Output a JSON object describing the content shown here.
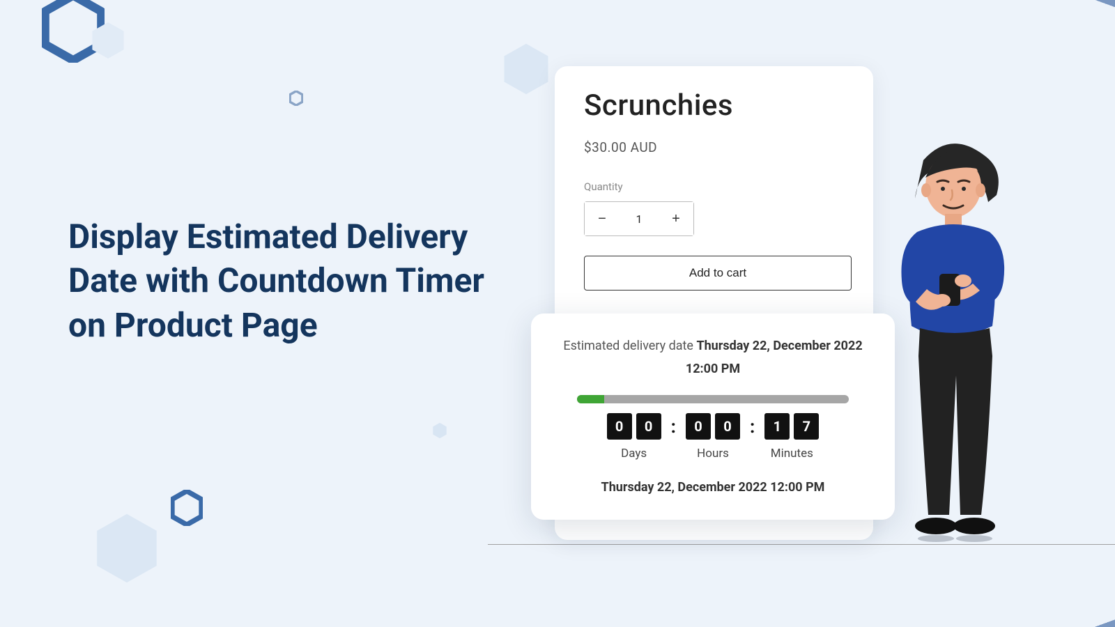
{
  "headline": "Display Estimated Delivery Date with Countdown Timer on Product Page",
  "product": {
    "title": "Scrunchies",
    "price": "$30.00 AUD",
    "quantity_label": "Quantity",
    "quantity_value": "1",
    "add_to_cart_label": "Add to cart"
  },
  "delivery": {
    "prefix": "Estimated delivery date ",
    "date_bold": "Thursday 22, December 2022 12:00 PM",
    "progress_percent": 10,
    "countdown": {
      "days": [
        "0",
        "0"
      ],
      "hours": [
        "0",
        "0"
      ],
      "minutes": [
        "1",
        "7"
      ],
      "labels": {
        "days": "Days",
        "hours": "Hours",
        "minutes": "Minutes"
      }
    },
    "bottom_date": "Thursday 22, December 2022 12:00 PM"
  }
}
